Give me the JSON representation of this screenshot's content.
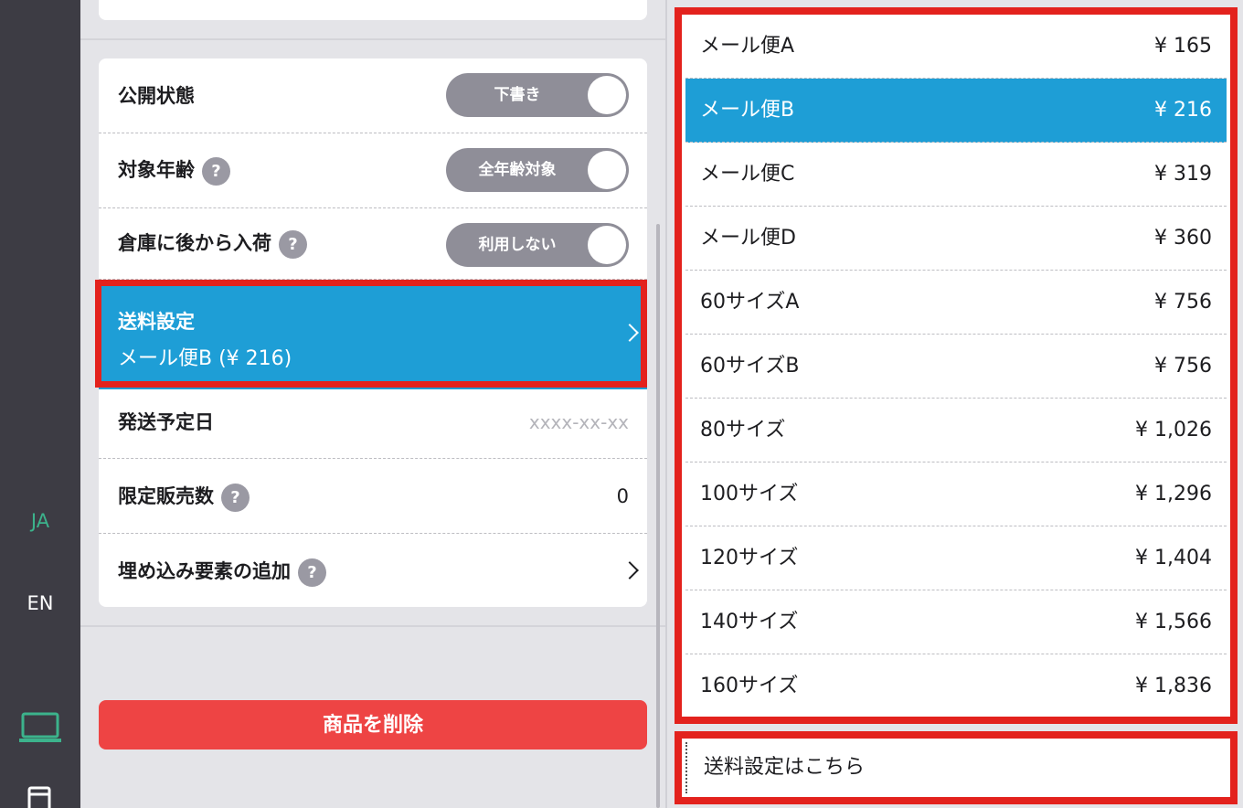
{
  "sidebar": {
    "lang_ja": "JA",
    "lang_en": "EN",
    "icons": [
      "laptop-icon",
      "window-icon"
    ],
    "active_color": "#3cb38c"
  },
  "settings": {
    "rows": [
      {
        "label": "公開状態",
        "toggle": "下書き"
      },
      {
        "label": "対象年齢",
        "help": "?",
        "toggle": "全年齢対象"
      },
      {
        "label": "倉庫に後から入荷",
        "help": "?",
        "toggle": "利用しない"
      }
    ],
    "shipping": {
      "title": "送料設定",
      "value": "メール便B (¥ 216)"
    },
    "ship_date": {
      "label": "発送予定日",
      "placeholder": "xxxx-xx-xx"
    },
    "limited": {
      "label": "限定販売数",
      "help": "?",
      "value": "0"
    },
    "embed": {
      "label": "埋め込み要素の追加",
      "help": "?"
    }
  },
  "delete_button": "商品を削除",
  "rates": {
    "items": [
      {
        "name": "メール便A",
        "price": "¥ 165"
      },
      {
        "name": "メール便B",
        "price": "¥ 216",
        "selected": true
      },
      {
        "name": "メール便C",
        "price": "¥ 319"
      },
      {
        "name": "メール便D",
        "price": "¥ 360"
      },
      {
        "name": "60サイズA",
        "price": "¥ 756"
      },
      {
        "name": "60サイズB",
        "price": "¥ 756"
      },
      {
        "name": "80サイズ",
        "price": "¥ 1,026"
      },
      {
        "name": "100サイズ",
        "price": "¥ 1,296"
      },
      {
        "name": "120サイズ",
        "price": "¥ 1,404"
      },
      {
        "name": "140サイズ",
        "price": "¥ 1,566"
      },
      {
        "name": "160サイズ",
        "price": "¥ 1,836"
      }
    ],
    "settings_link": "送料設定はこちら"
  },
  "colors": {
    "accent": "#1e9ed6",
    "danger": "#ee4444",
    "highlight": "#e3221d",
    "rail": "#3d3c44"
  }
}
